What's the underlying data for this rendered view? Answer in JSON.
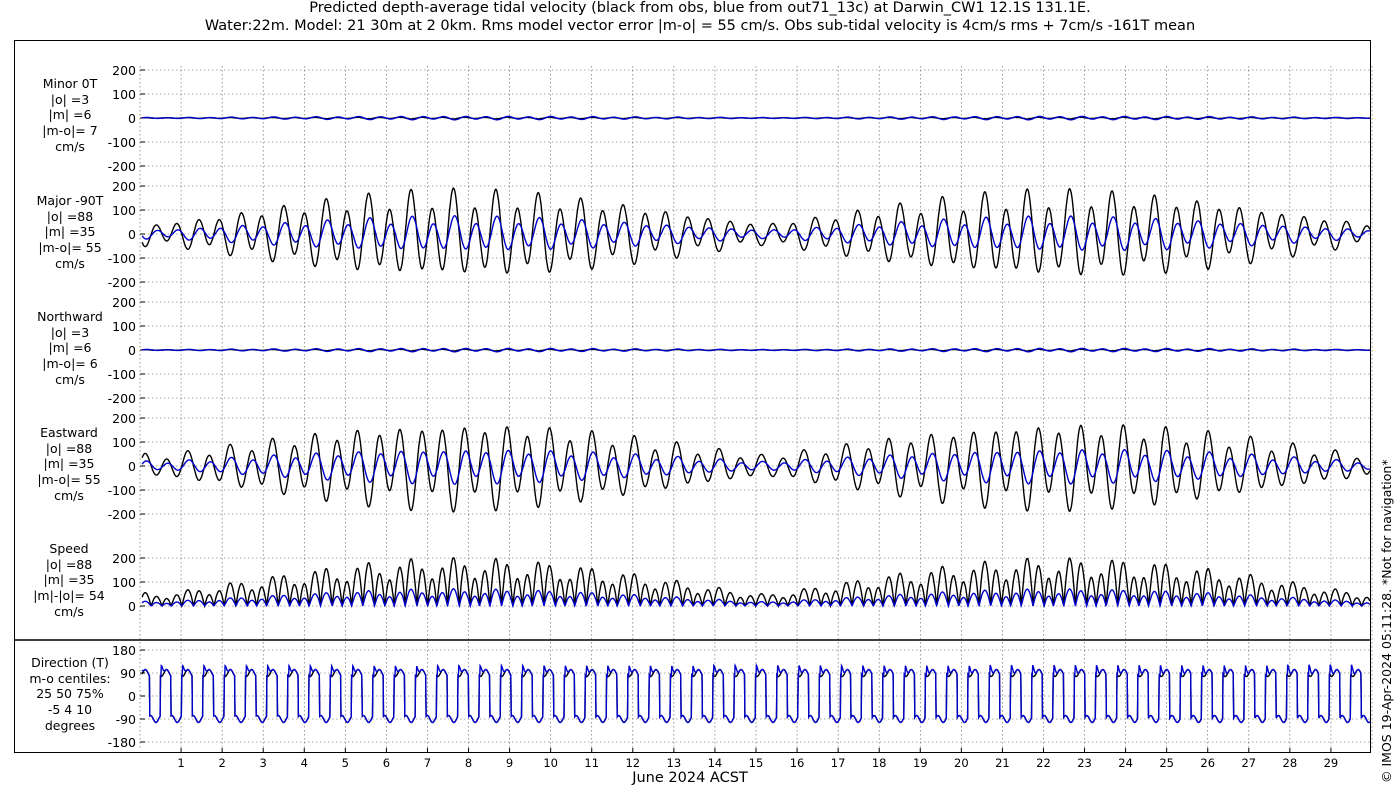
{
  "title_line1": "Predicted depth-average tidal velocity (black from obs, blue from out71_13c) at Darwin_CW1 12.1S 131.1E.",
  "title_line2": "Water:22m. Model: 21 30m at 2 0km. Rms model vector error |m-o| = 55 cm/s. Obs sub-tidal velocity is 4cm/s rms + 7cm/s -161T mean",
  "credit": "© IMOS 19-Apr-2024 05:11:28. *Not for navigation*",
  "colors": {
    "obs": "#000000",
    "model": "#0000cc",
    "grid": "#555555"
  },
  "chart_data": {
    "type": "line",
    "xlabel": "June 2024 ACST",
    "x_ticks": [
      "1",
      "2",
      "3",
      "4",
      "5",
      "6",
      "7",
      "8",
      "9",
      "10",
      "11",
      "12",
      "13",
      "14",
      "15",
      "16",
      "17",
      "18",
      "19",
      "20",
      "21",
      "22",
      "23",
      "24",
      "25",
      "26",
      "27",
      "28",
      "29"
    ],
    "xlim_days": [
      0,
      30
    ],
    "series_names": [
      "obs",
      "model"
    ],
    "panels": [
      {
        "id": "minor",
        "label_lines": [
          "Minor 0T",
          "|o| =3",
          "|m| =6",
          "|m-o|= 7",
          "cm/s"
        ],
        "yticks": [
          "200",
          "100",
          "0",
          "-100",
          "-200"
        ],
        "ylim": [
          -200,
          200
        ],
        "amplitude": {
          "obs": 3,
          "model": 6
        }
      },
      {
        "id": "major",
        "label_lines": [
          "Major -90T",
          "|o| =88",
          "|m| =35",
          "|m-o|= 55",
          "cm/s"
        ],
        "yticks": [
          "200",
          "100",
          "0",
          "-100",
          "-200"
        ],
        "ylim": [
          -200,
          200
        ],
        "amplitude": {
          "obs": 88,
          "model": 35
        }
      },
      {
        "id": "northward",
        "label_lines": [
          "Northward",
          "|o| =3",
          "|m| =6",
          "|m-o|= 6",
          "cm/s"
        ],
        "yticks": [
          "200",
          "100",
          "0",
          "-100",
          "-200"
        ],
        "ylim": [
          -200,
          200
        ],
        "amplitude": {
          "obs": 3,
          "model": 6
        }
      },
      {
        "id": "eastward",
        "label_lines": [
          "Eastward",
          "|o| =88",
          "|m| =35",
          "|m-o|= 55",
          "cm/s"
        ],
        "yticks": [
          "200",
          "100",
          "0",
          "-100",
          "-200"
        ],
        "ylim": [
          -200,
          200
        ],
        "amplitude": {
          "obs": 88,
          "model": 35
        }
      },
      {
        "id": "speed",
        "label_lines": [
          "Speed",
          "|o| =88",
          "|m| =35",
          "|m|-|o|= 54",
          "cm/s"
        ],
        "yticks": [
          "200",
          "100",
          "0"
        ],
        "ylim": [
          0,
          200
        ],
        "amplitude": {
          "obs": 88,
          "model": 35
        }
      },
      {
        "id": "direction",
        "label_lines": [
          "Direction (T)",
          "m-o centiles:",
          "25  50  75%",
          "-5   4  10",
          "degrees"
        ],
        "yticks": [
          "180",
          "90",
          "0",
          "-90",
          "-180"
        ],
        "ylim": [
          -180,
          180
        ]
      }
    ]
  }
}
